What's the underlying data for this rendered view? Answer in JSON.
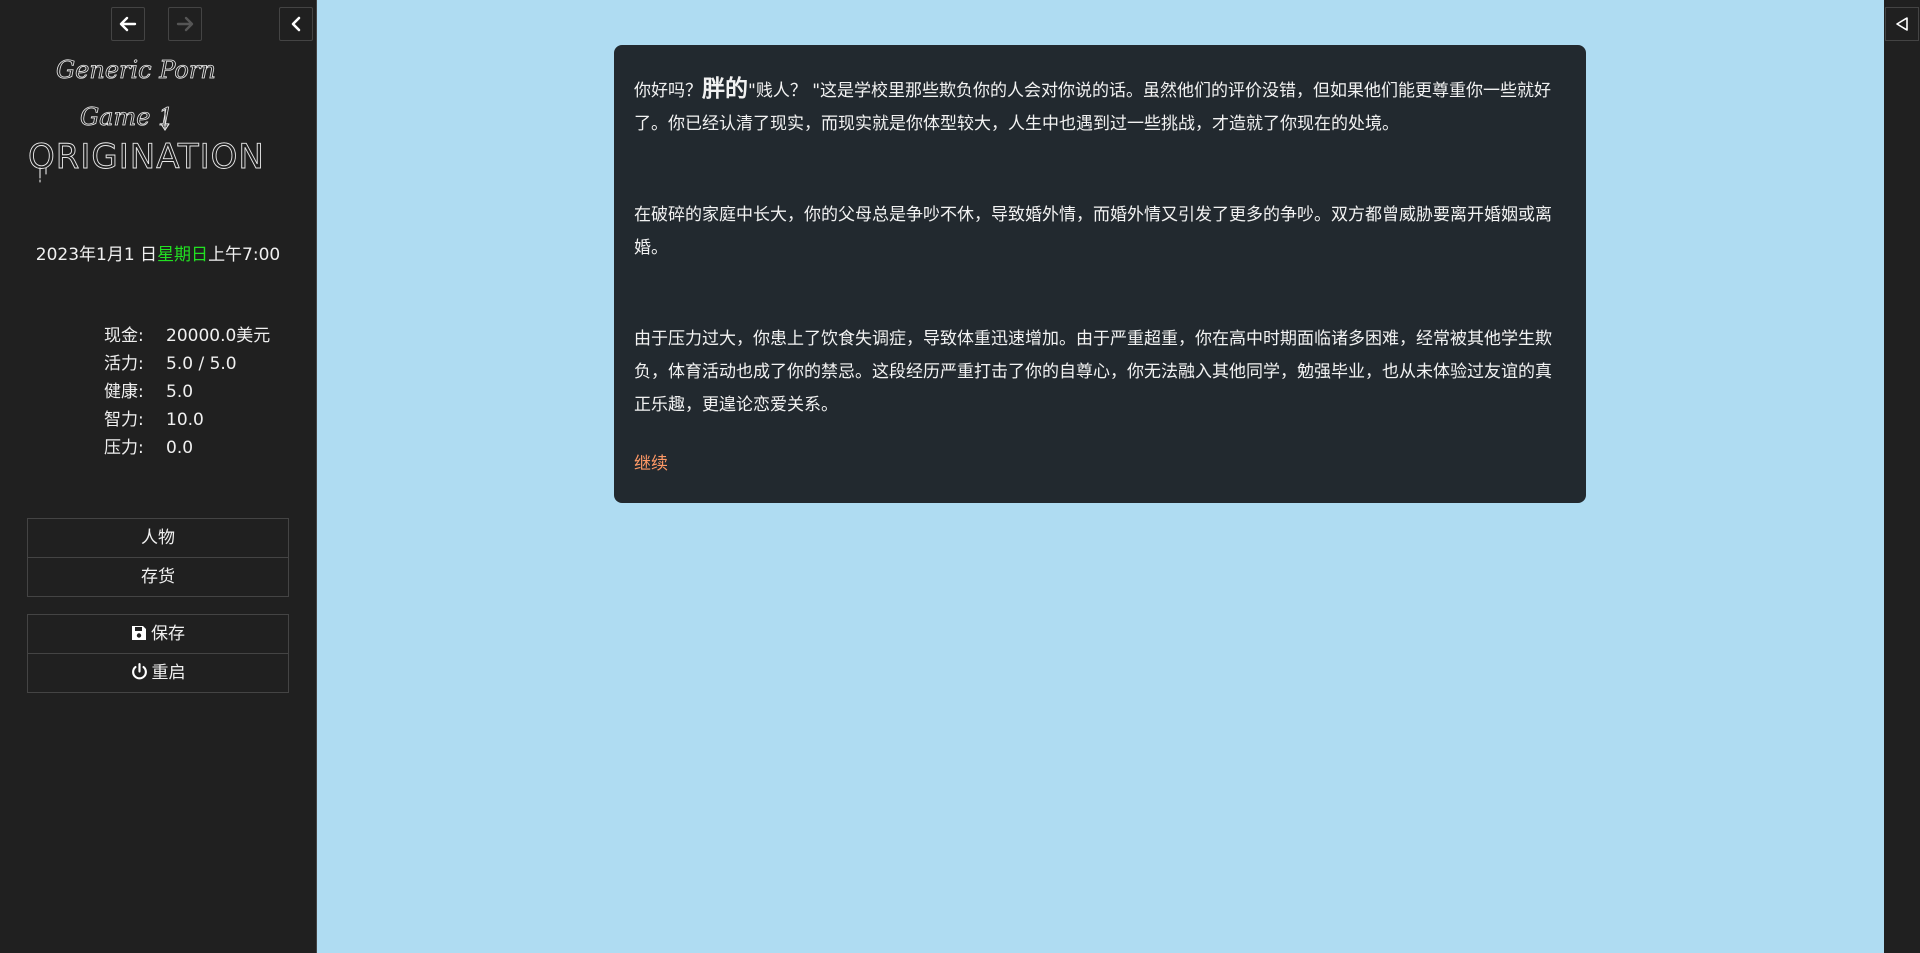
{
  "sidebar": {
    "nav": {
      "back_icon": "arrow-left-icon",
      "forward_icon": "arrow-right-icon",
      "collapse_icon": "chevron-left-icon"
    },
    "logo": {
      "line1": "Generic Porn",
      "line2": "Game 1",
      "line3": "ORIGINATION"
    },
    "date": {
      "prefix": "2023年1月1 日",
      "weekday": "星期日",
      "time": "上午7:00",
      "weekday_color": "#22e022"
    },
    "stats": [
      {
        "label": "现金:",
        "value": "20000.0美元"
      },
      {
        "label": "活力:",
        "value": "5.0 / 5.0"
      },
      {
        "label": "健康:",
        "value": "5.0"
      },
      {
        "label": "智力:",
        "value": "10.0"
      },
      {
        "label": "压力:",
        "value": "0.0"
      }
    ],
    "menu": {
      "character": "人物",
      "inventory": "存货"
    },
    "actions": {
      "save": "保存",
      "save_icon": "floppy-disk-icon",
      "restart": "重启",
      "restart_icon": "power-icon"
    }
  },
  "right_panel": {
    "toggle_icon": "triangle-left-icon"
  },
  "passage": {
    "p1_prefix": "你好吗？",
    "p1_emph": "胖的",
    "p1_rest": "\"贱人？ \"这是学校里那些欺负你的人会对你说的话。虽然他们的评价没错，但如果他们能更尊重你一些就好了。你已经认清了现实，而现实就是你体型较大，人生中也遇到过一些挑战，才造就了你现在的处境。",
    "p2": "在破碎的家庭中长大，你的父母总是争吵不休，导致婚外情，而婚外情又引发了更多的争吵。双方都曾威胁要离开婚姻或离婚。",
    "p3": "由于压力过大，你患上了饮食失调症，导致体重迅速增加。由于严重超重，你在高中时期面临诸多困难，经常被其他学生欺负，体育活动也成了你的禁忌。这段经历严重打击了你的自尊心，你无法融入其他同学，勉强毕业，也从未体验过友谊的真正乐趣，更遑论恋爱关系。",
    "continue": "继续",
    "link_color": "#ff9966"
  },
  "colors": {
    "background": "#afdcf2",
    "sidebar": "#202020",
    "passage_bg": "#22292f"
  }
}
